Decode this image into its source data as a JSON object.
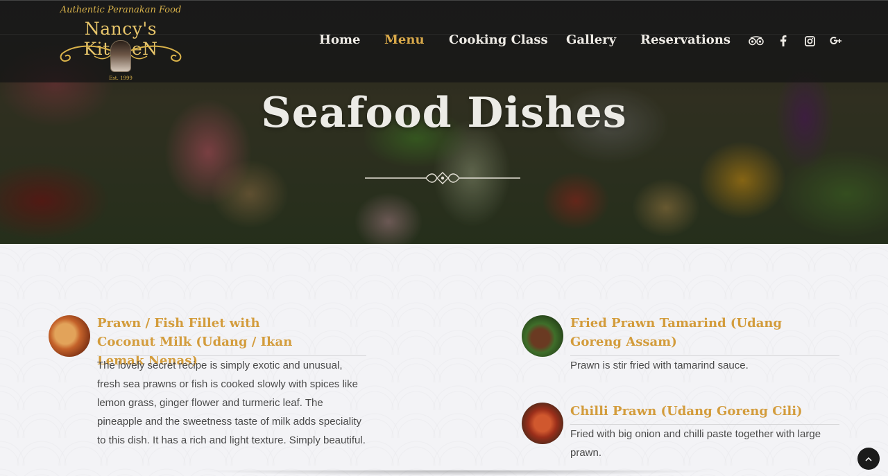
{
  "brand": {
    "tagline": "Authentic Peranakan Food",
    "name": "Nancy's KitcheN",
    "established": "Est. 1999"
  },
  "nav": {
    "items": [
      {
        "label": "Home",
        "active": false
      },
      {
        "label": "Menu",
        "active": true
      },
      {
        "label": "Cooking Class",
        "active": false
      },
      {
        "label": "Gallery",
        "active": false
      },
      {
        "label": "Reservations",
        "active": false
      }
    ],
    "social_icons": [
      "tripadvisor-icon",
      "facebook-icon",
      "instagram-icon",
      "google-plus-icon"
    ]
  },
  "hero": {
    "title": "Seafood Dishes"
  },
  "dishes": {
    "left": [
      {
        "title": "Prawn / Fish Fillet with Coconut Milk (Udang / Ikan Lemak Nenas)",
        "description": "The lovely secret recipe is simply exotic and unusual, fresh sea prawns or fish is cooked slowly with spices like lemon grass, ginger flower and turmeric leaf. The pineapple and the sweetness taste of milk adds speciality to this dish. It has a rich and light texture. Simply beautiful."
      }
    ],
    "right": [
      {
        "title": "Fried Prawn Tamarind (Udang Goreng Assam)",
        "description": "Prawn is stir fried with tamarind sauce."
      },
      {
        "title": "Chilli Prawn (Udang Goreng Cili)",
        "description": "Fried with big onion and chilli paste together with large prawn."
      }
    ]
  },
  "colors": {
    "accent": "#d39c3c",
    "nav_active": "#d9a94a",
    "header_bg": "#191919"
  }
}
